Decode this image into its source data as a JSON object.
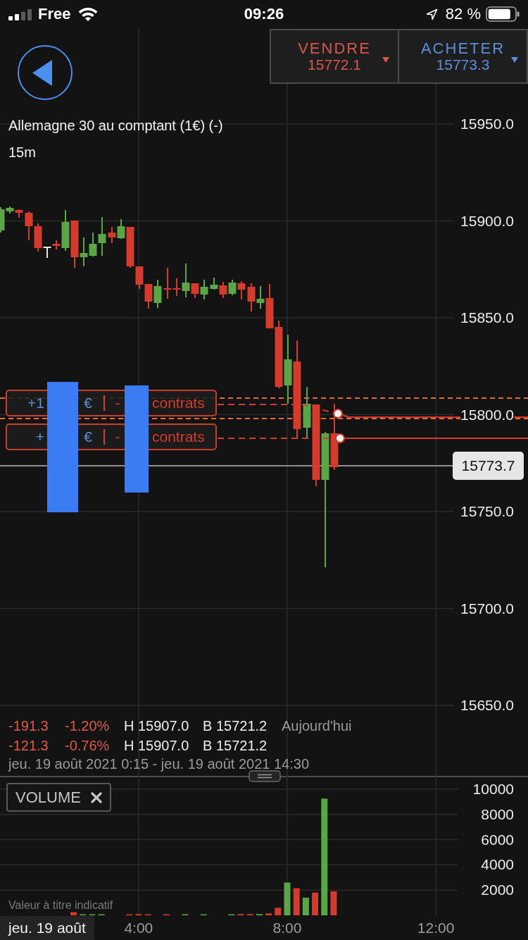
{
  "status_bar": {
    "carrier": "Free",
    "time": "09:26",
    "battery": "82 %"
  },
  "trade_buttons": [
    {
      "kind": "sell",
      "label": "VENDRE",
      "price": "15772.1"
    },
    {
      "kind": "buy",
      "label": "ACHETER",
      "price": "15773.3"
    }
  ],
  "instrument": {
    "title": "Allemagne 30 au comptant (1€) (-)",
    "interval": "15m"
  },
  "price_chart": {
    "axis_labels": [
      "15950.0",
      "15900.0",
      "15850.0",
      "15800.0",
      "15750.0",
      "15700.0",
      "15650.0"
    ],
    "current_price": "15773.7",
    "orders": [
      {
        "amount": "+1",
        "currency": "€",
        "sign": "-",
        "unit": "contrats"
      },
      {
        "amount": "+",
        "currency": "€",
        "sign": "-",
        "unit": "contrats"
      }
    ]
  },
  "stats": [
    {
      "change": "-191.3",
      "percent": "-1.20%",
      "high": "H 15907.0",
      "low": "B 15721.2",
      "period": "Aujourd'hui"
    },
    {
      "change": "-121.3",
      "percent": "-0.76%",
      "high": "H 15907.0",
      "low": "B 15721.2"
    }
  ],
  "date_range": "jeu. 19 août 2021 0:15 - jeu. 19 août 2021 14:30",
  "volume": {
    "label": "VOLUME",
    "note": "Valeur à titre indicatif",
    "chart_data": {
      "type": "bar",
      "x": [
        2.25,
        2.5,
        2.75,
        3,
        3.75,
        4,
        4.25,
        4.75,
        5.25,
        5.75,
        6.5,
        6.75,
        7,
        7.25,
        7.5,
        7.75,
        8,
        8.25,
        8.5,
        8.75,
        9,
        9.25
      ],
      "series": [
        {
          "color": "#5aa546",
          "values": [
            null,
            50,
            50,
            50,
            null,
            null,
            null,
            null,
            50,
            50,
            50,
            null,
            null,
            100,
            null,
            null,
            2600,
            null,
            1400,
            null,
            9250,
            null
          ]
        },
        {
          "color": "#d43b2d",
          "values": [
            250,
            null,
            null,
            null,
            50,
            100,
            60,
            50,
            null,
            null,
            null,
            100,
            100,
            null,
            150,
            600,
            null,
            2150,
            null,
            1800,
            null,
            1900
          ]
        }
      ],
      "xlim": [
        0.27,
        14.48
      ],
      "ylim": [
        0,
        11000
      ],
      "xticks": [
        {
          "value": 4,
          "label": "4:00"
        },
        {
          "value": 8,
          "label": "8:00"
        },
        {
          "value": 12,
          "label": "12:00"
        }
      ],
      "yticks": [
        {
          "value": 2000,
          "label": "2000"
        },
        {
          "value": 4000,
          "label": "4000"
        },
        {
          "value": 6000,
          "label": "6000"
        },
        {
          "value": 8000,
          "label": "8000"
        },
        {
          "value": 10000,
          "label": "10000"
        }
      ],
      "grid": true
    }
  },
  "time_axis": {
    "date": "jeu. 19 août"
  }
}
